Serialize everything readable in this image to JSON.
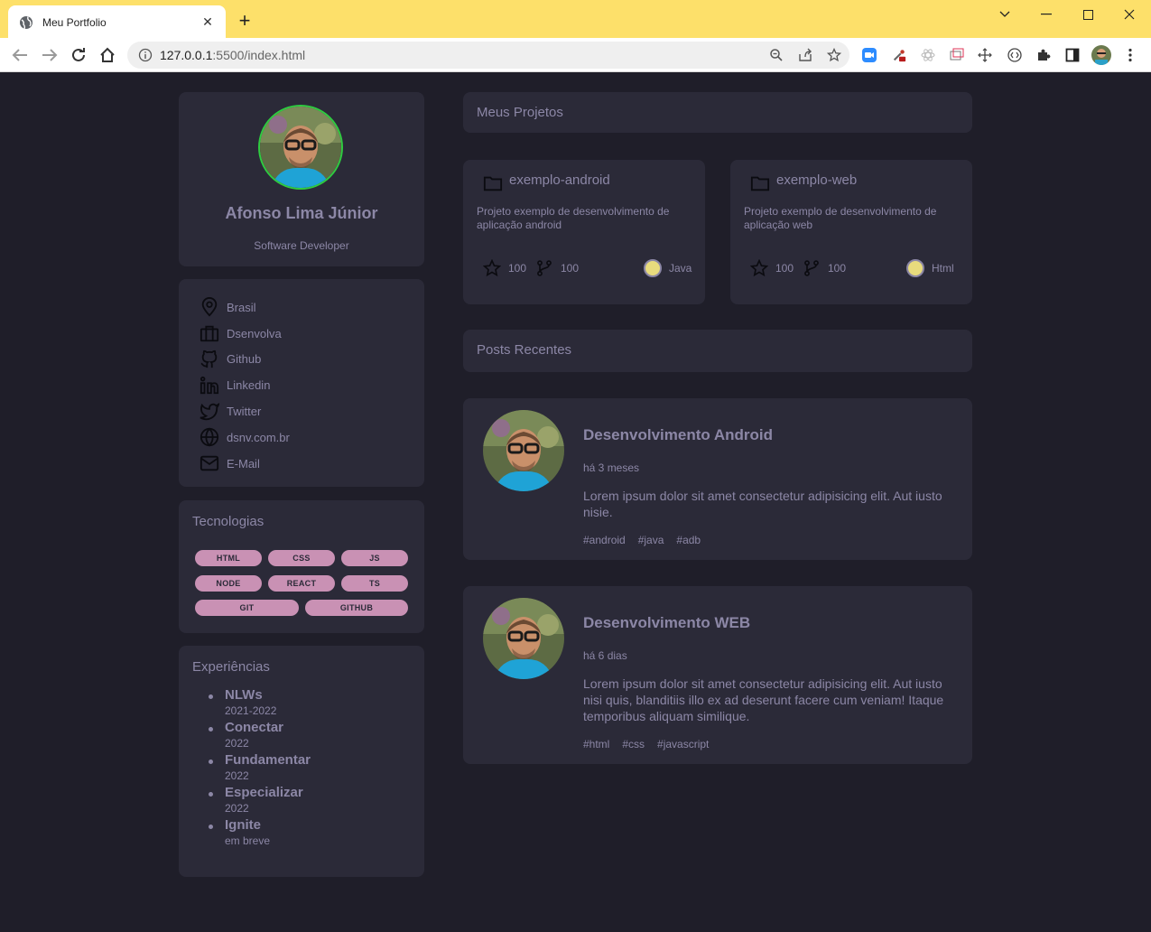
{
  "browser": {
    "tab_title": "Meu Portfolio",
    "url_host": "127.0.0.1",
    "url_rest": ":5500/index.html"
  },
  "profile": {
    "name": "Afonso Lima Júnior",
    "role": "Software Developer"
  },
  "links": [
    {
      "icon": "map-pin-icon",
      "label": "Brasil"
    },
    {
      "icon": "briefcase-icon",
      "label": "Dsenvolva"
    },
    {
      "icon": "github-icon",
      "label": "Github"
    },
    {
      "icon": "linkedin-icon",
      "label": "Linkedin"
    },
    {
      "icon": "twitter-icon",
      "label": "Twitter"
    },
    {
      "icon": "globe-icon",
      "label": "dsnv.com.br"
    },
    {
      "icon": "mail-icon",
      "label": "E-Mail"
    }
  ],
  "technologies": {
    "title": "Tecnologias",
    "tags": [
      "HTML",
      "CSS",
      "JS",
      "NODE",
      "REACT",
      "TS",
      "GIT",
      "GITHUB"
    ]
  },
  "experiences": {
    "title": "Experiências",
    "items": [
      {
        "name": "NLWs",
        "date": "2021-2022"
      },
      {
        "name": "Conectar",
        "date": "2022"
      },
      {
        "name": "Fundamentar",
        "date": "2022"
      },
      {
        "name": "Especializar",
        "date": "2022"
      },
      {
        "name": "Ignite",
        "date": "em breve"
      }
    ]
  },
  "projects": {
    "title": "Meus Projetos",
    "items": [
      {
        "name": "exemplo-android",
        "description": "Projeto exemplo de desenvolvimento de aplicação android",
        "stars": "100",
        "forks": "100",
        "language": "Java"
      },
      {
        "name": "exemplo-web",
        "description": "Projeto exemplo de desenvolvimento de aplicação web",
        "stars": "100",
        "forks": "100",
        "language": "Html"
      }
    ]
  },
  "posts": {
    "title": "Posts Recentes",
    "items": [
      {
        "title": "Desenvolvimento Android",
        "date": "há 3 meses",
        "body": "Lorem ipsum dolor sit amet consectetur adipisicing elit. Aut iusto nisie.",
        "tags": [
          "#android",
          "#java",
          "#adb"
        ]
      },
      {
        "title": "Desenvolvimento WEB",
        "date": "há 6 dias",
        "body": "Lorem ipsum dolor sit amet consectetur adipisicing elit. Aut iusto nisi quis, blanditiis illo ex ad deserunt facere cum veniam! Itaque temporibus aliquam similique.",
        "tags": [
          "#html",
          "#css",
          "#javascript"
        ]
      }
    ]
  },
  "colors": {
    "background": "#1f1e29",
    "card": "#2b2a38",
    "text": "#8c87a6",
    "tag": "#c991b4",
    "language_dot": "#e8db7d",
    "tabbar": "#fde06a"
  }
}
